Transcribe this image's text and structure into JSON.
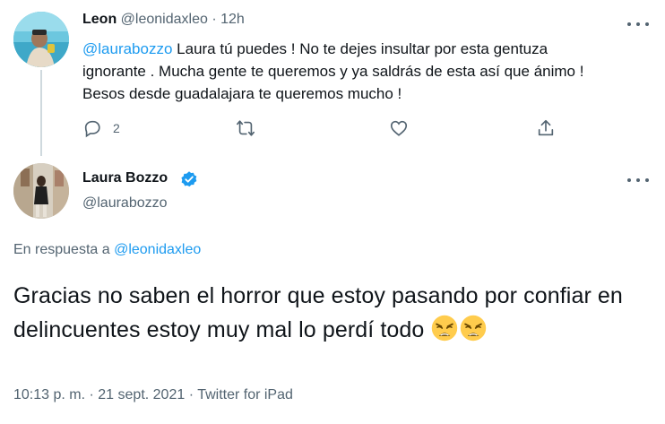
{
  "reply_tweet": {
    "author_name": "Leon",
    "author_handle": "@leonidaxleo",
    "separator": "·",
    "time_ago": "12h",
    "mention": "@laurabozzo",
    "text": " Laura tú puedes ! No te dejes insultar por esta gentuza\nignorante . Mucha gente te queremos y ya saldrás de esta así que ánimo !\nBesos desde guadalajara te queremos mucho !",
    "actions": {
      "reply_icon": "reply-icon",
      "reply_count": "2",
      "retweet_icon": "retweet-icon",
      "like_icon": "heart-icon",
      "share_icon": "share-icon"
    }
  },
  "main_tweet": {
    "author_name": "Laura Bozzo",
    "author_handle": "@laurabozzo",
    "verified_icon": "verified-badge-icon",
    "in_reply_prefix": "En respuesta a ",
    "in_reply_handle": "@leonidaxleo",
    "text_line": "Gracias no saben el horror que estoy pasando por confiar en delincuentes estoy muy mal lo perdí todo ",
    "emoji": "weary-face-emoji",
    "time": "10:13 p. m.",
    "date": "21 sept. 2021",
    "source": "Twitter for iPad",
    "separator": "·"
  },
  "colors": {
    "text": "#0f1419",
    "secondary": "#536471",
    "link": "#1d9bf0",
    "thread_line": "#cfd9de"
  }
}
